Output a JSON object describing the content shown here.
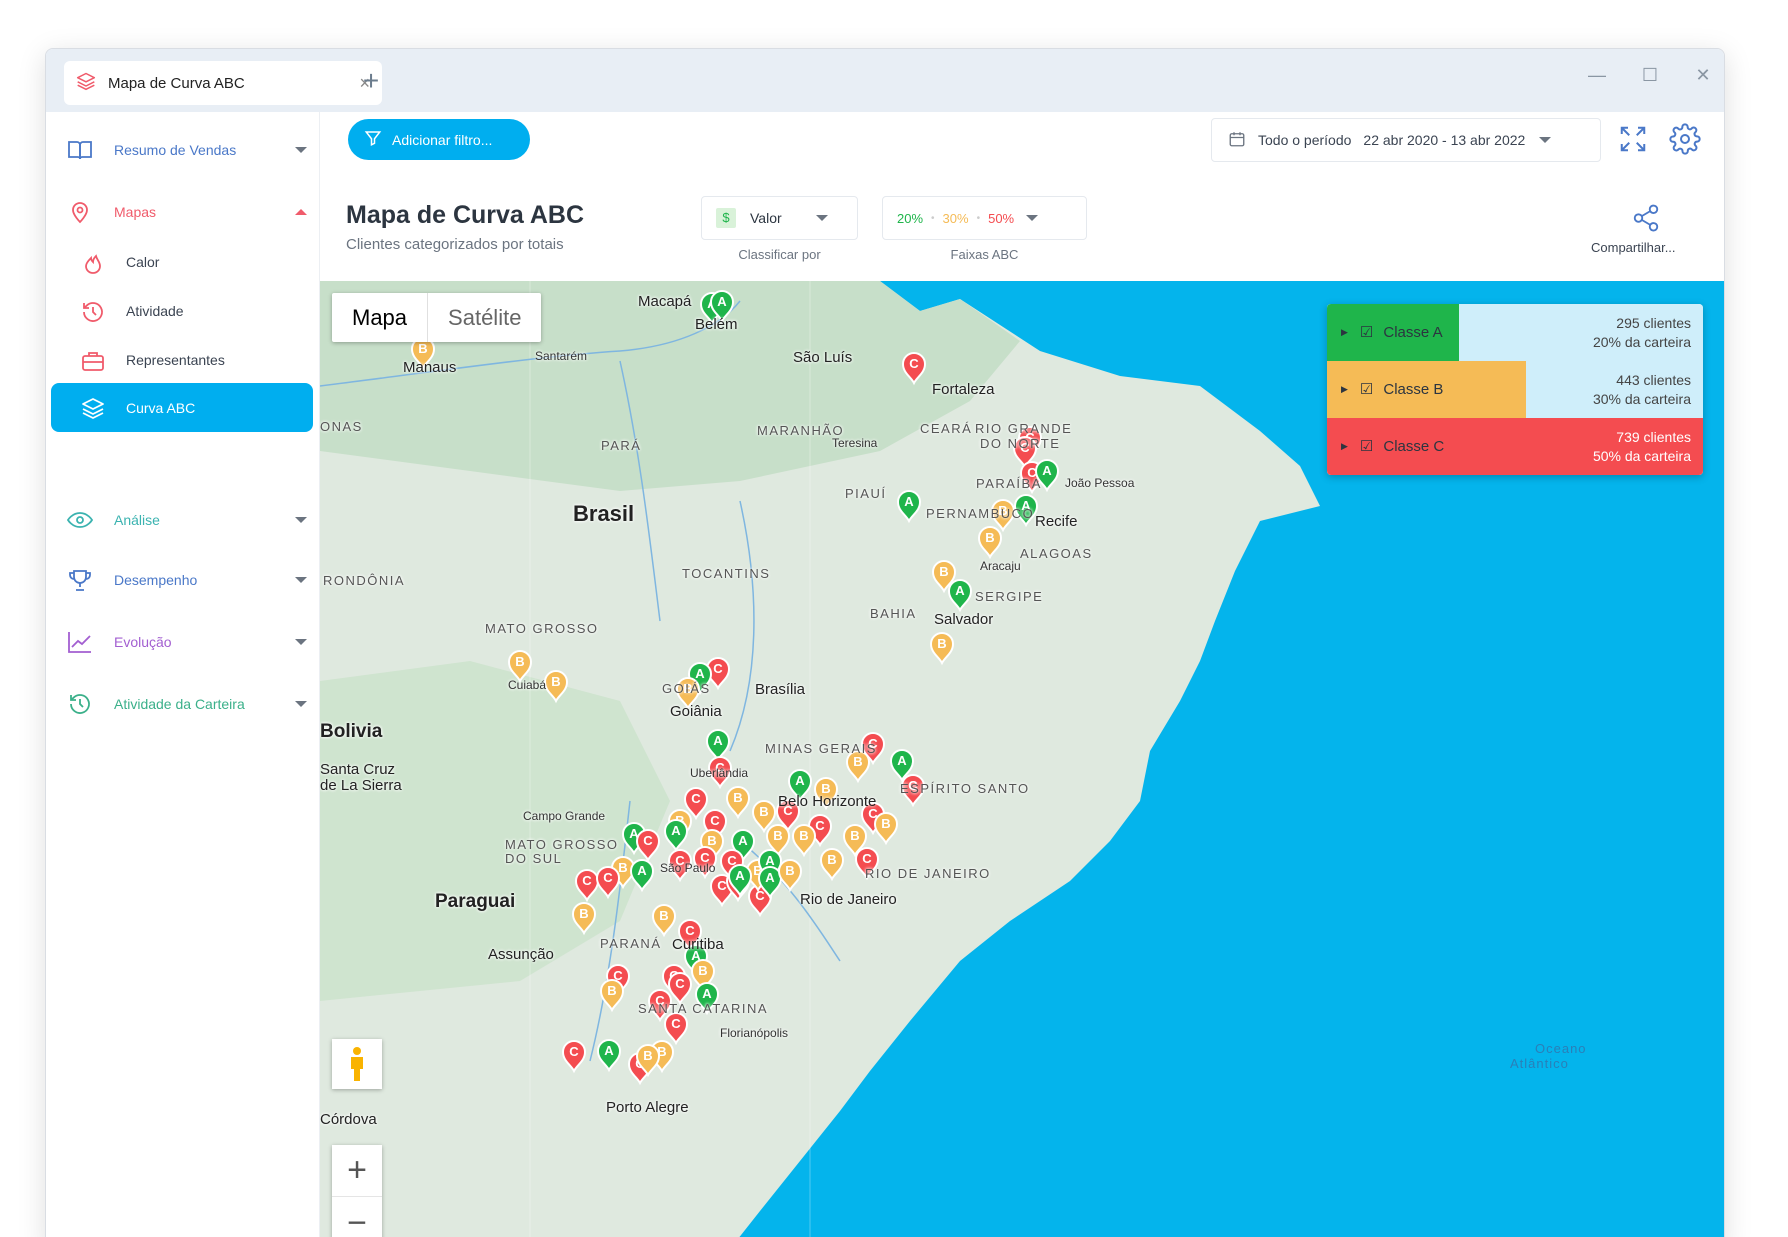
{
  "window": {
    "tab_title": "Mapa de Curva ABC",
    "tab_close": "×",
    "new_tab": "+",
    "minimize": "—",
    "maximize": "☐",
    "close": "✕"
  },
  "sidebar": {
    "items": [
      {
        "label": "Resumo de Vendas",
        "icon": "book-icon",
        "color": "#4a78c8"
      },
      {
        "label": "Mapas",
        "icon": "map-pin-icon",
        "color": "#f05b6b"
      },
      {
        "label": "Análise",
        "icon": "eye-icon",
        "color": "#3bb3b0"
      },
      {
        "label": "Desempenho",
        "icon": "trophy-icon",
        "color": "#4a78c8"
      },
      {
        "label": "Evolução",
        "icon": "line-chart-icon",
        "color": "#a35fd1"
      },
      {
        "label": "Atividade da Carteira",
        "icon": "history-icon",
        "color": "#3bb08a"
      }
    ],
    "subitems": [
      {
        "label": "Calor",
        "icon": "flame-icon"
      },
      {
        "label": "Atividade",
        "icon": "history-icon"
      },
      {
        "label": "Representantes",
        "icon": "briefcase-icon"
      },
      {
        "label": "Curva ABC",
        "icon": "layers-icon",
        "active": true
      }
    ]
  },
  "toolbar": {
    "filter_button": "Adicionar filtro...",
    "period_label": "Todo o período",
    "period_range": "22 abr 2020 - 13 abr 2022",
    "share_label": "Compartilhar..."
  },
  "header": {
    "title": "Mapa de Curva ABC",
    "subtitle": "Clientes categorizados por totais"
  },
  "controls": {
    "sort_value": "Valor",
    "sort_caption": "Classificar por",
    "bands": [
      "20%",
      "30%",
      "50%"
    ],
    "bands_caption": "Faixas ABC"
  },
  "map": {
    "type_buttons": [
      "Mapa",
      "Satélite"
    ],
    "zoom_in": "+",
    "zoom_out": "−",
    "labels": [
      {
        "text": "Macapá",
        "kind": "city"
      },
      {
        "text": "Santarém",
        "kind": "small"
      },
      {
        "text": "São Luís",
        "kind": "city"
      },
      {
        "text": "Fortaleza",
        "kind": "city"
      },
      {
        "text": "Teresina",
        "kind": "small"
      },
      {
        "text": "MARANHÃO",
        "kind": "state"
      },
      {
        "text": "CEARÁ",
        "kind": "state"
      },
      {
        "text": "RIO GRANDE",
        "kind": "state"
      },
      {
        "text": "DO NORTE",
        "kind": "state"
      },
      {
        "text": "PARAÍBA",
        "kind": "state"
      },
      {
        "text": "João Pessoa",
        "kind": "small"
      },
      {
        "text": "PARÁ",
        "kind": "state"
      },
      {
        "text": "PIAUÍ",
        "kind": "state"
      },
      {
        "text": "PERNAMBUCO",
        "kind": "state"
      },
      {
        "text": "Recife",
        "kind": "city"
      },
      {
        "text": "ALAGOAS",
        "kind": "state"
      },
      {
        "text": "Aracaju",
        "kind": "small"
      },
      {
        "text": "SERGIPE",
        "kind": "state"
      },
      {
        "text": "Brasil",
        "kind": "big"
      },
      {
        "text": "TOCANTINS",
        "kind": "state"
      },
      {
        "text": "BAHIA",
        "kind": "state"
      },
      {
        "text": "Salvador",
        "kind": "city"
      },
      {
        "text": "RONDÔNIA",
        "kind": "state"
      },
      {
        "text": "MATO GROSSO",
        "kind": "state"
      },
      {
        "text": "Cuiabá",
        "kind": "small"
      },
      {
        "text": "GOIÁS",
        "kind": "state"
      },
      {
        "text": "Goiânia",
        "kind": "city"
      },
      {
        "text": "Brasília",
        "kind": "city"
      },
      {
        "text": "Bolivia",
        "kind": "bigc"
      },
      {
        "text": "Santa Cruz",
        "kind": "city"
      },
      {
        "text": "de La Sierra",
        "kind": "city"
      },
      {
        "text": "MINAS GERAIS",
        "kind": "state"
      },
      {
        "text": "Uberlândia",
        "kind": "small"
      },
      {
        "text": "Belo Horizonte",
        "kind": "city"
      },
      {
        "text": "ESPÍRITO SANTO",
        "kind": "state"
      },
      {
        "text": "Campo Grande",
        "kind": "small"
      },
      {
        "text": "MATO GROSSO",
        "kind": "state"
      },
      {
        "text": "DO SUL",
        "kind": "state"
      },
      {
        "text": "RIO DE JANEIRO",
        "kind": "state"
      },
      {
        "text": "Rio de Janeiro",
        "kind": "city"
      },
      {
        "text": "Paraguai",
        "kind": "bigc"
      },
      {
        "text": "Assunção",
        "kind": "city"
      },
      {
        "text": "PARANÁ",
        "kind": "state"
      },
      {
        "text": "Curitiba",
        "kind": "city"
      },
      {
        "text": "SANTA CATARINA",
        "kind": "state"
      },
      {
        "text": "Florianópolis",
        "kind": "small"
      },
      {
        "text": "Porto Alegre",
        "kind": "city"
      },
      {
        "text": "Córdova",
        "kind": "city"
      },
      {
        "text": "Oceano",
        "kind": "ocean"
      },
      {
        "text": "Atlântico",
        "kind": "ocean"
      },
      {
        "text": "Belém",
        "kind": "city"
      },
      {
        "text": "Manaus",
        "kind": "city"
      },
      {
        "text": "ONAS",
        "kind": "state"
      },
      {
        "text": "São Paulo",
        "kind": "small"
      }
    ]
  },
  "legend": {
    "rows": [
      {
        "label": "Classe A",
        "count": "295 clientes",
        "share": "20% da carteira",
        "color": "#1fb54b",
        "fill_fraction": 0.35,
        "bg": "#cfeefa"
      },
      {
        "label": "Classe B",
        "count": "443 clientes",
        "share": "30% da carteira",
        "color": "#f5bb56",
        "fill_fraction": 0.53,
        "bg": "#cfeefa"
      },
      {
        "label": "Classe C",
        "count": "739 clientes",
        "share": "50% da carteira",
        "color": "#f44c50",
        "fill_fraction": 1.0,
        "bg": "#cfeefa"
      }
    ]
  },
  "colors": {
    "accent": "#00aeef",
    "class_a": "#1fb54b",
    "class_b": "#f5bb56",
    "class_c": "#f44c50",
    "ocean": "#04b4ec",
    "land": "#dfe9df"
  }
}
